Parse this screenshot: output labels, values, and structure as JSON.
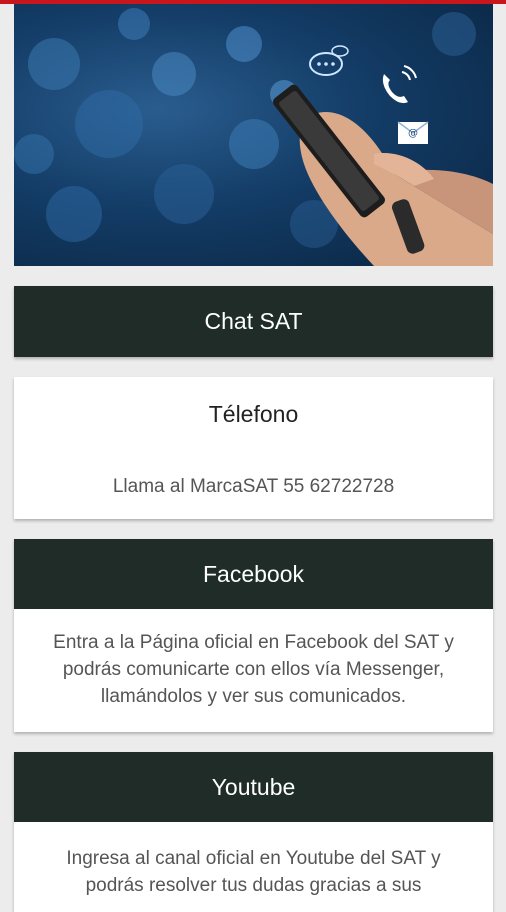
{
  "colors": {
    "accent_red": "#c8161d",
    "header_dark": "#1f2c28",
    "background": "#ececec",
    "card": "#ffffff"
  },
  "hero": {
    "icons": [
      "chat-bubble-icon",
      "phone-call-icon",
      "email-icon"
    ]
  },
  "cards": {
    "chat": {
      "title": "Chat SAT"
    },
    "phone": {
      "title": "Télefono",
      "body": "Llama al MarcaSAT 55 62722728"
    },
    "facebook": {
      "title": "Facebook",
      "body": "Entra a la Página oficial en Facebook del SAT y podrás comunicarte con ellos vía Messenger, llamándolos y ver sus comunicados."
    },
    "youtube": {
      "title": "Youtube",
      "body": "Ingresa al canal oficial en Youtube del SAT y podrás resolver tus dudas gracias a sus"
    }
  }
}
